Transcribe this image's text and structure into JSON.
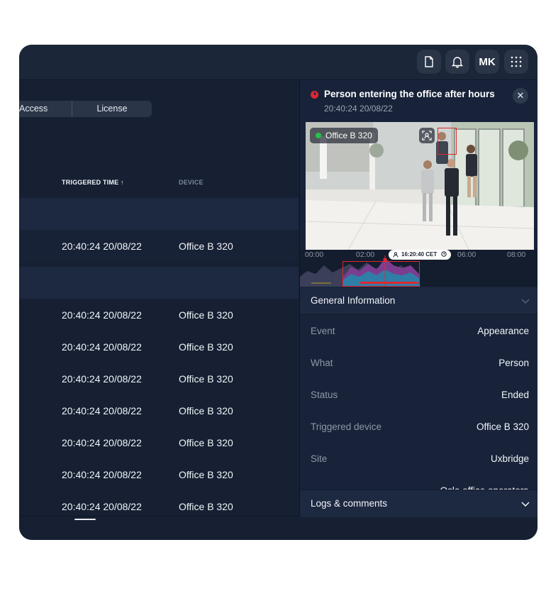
{
  "header": {
    "user_initials": "MK"
  },
  "filters": {
    "segments": [
      "Access",
      "License plate"
    ]
  },
  "table": {
    "columns": [
      {
        "label": "TRIGGERED TIME ↑",
        "active": true
      },
      {
        "label": "DEVICE",
        "active": false
      }
    ],
    "rows": [
      {
        "time": "",
        "device": ""
      },
      {
        "time": "20:40:24 20/08/22",
        "device": "Office B 320"
      },
      {
        "time": "",
        "device": ""
      },
      {
        "time": "20:40:24 20/08/22",
        "device": "Office B 320"
      },
      {
        "time": "20:40:24 20/08/22",
        "device": "Office B 320"
      },
      {
        "time": "20:40:24 20/08/22",
        "device": "Office B 320"
      },
      {
        "time": "20:40:24 20/08/22",
        "device": "Office B 320"
      },
      {
        "time": "20:40:24 20/08/22",
        "device": "Office B 320"
      },
      {
        "time": "20:40:24 20/08/22",
        "device": "Office B 320"
      },
      {
        "time": "20:40:24 20/08/22",
        "device": "Office B 320"
      }
    ]
  },
  "alert": {
    "title": "Person entering the office after hours",
    "time": "20:40:24 20/08/22",
    "camera_name": "Office B 320",
    "status_color": "#e0262f"
  },
  "timeline": {
    "ticks": [
      "00:00",
      "02:00",
      "06:00",
      "08:00"
    ],
    "cursor": "16:20:40 CET"
  },
  "general_info": {
    "title": "General Information",
    "items": [
      {
        "key": "Event",
        "value": "Appearance"
      },
      {
        "key": "What",
        "value": "Person"
      },
      {
        "key": "Status",
        "value": "Ended"
      },
      {
        "key": "Triggered device",
        "value": "Office B 320"
      },
      {
        "key": "Site",
        "value": "Uxbridge"
      }
    ],
    "partial_value": "Oslo office operators"
  },
  "logs": {
    "title": "Logs & comments"
  },
  "icons": [
    "document-icon",
    "bell-icon",
    "apps-grid-icon",
    "alert-icon",
    "close-icon",
    "face-scan-icon",
    "user-icon",
    "clock-icon",
    "chevron-down-icon"
  ]
}
